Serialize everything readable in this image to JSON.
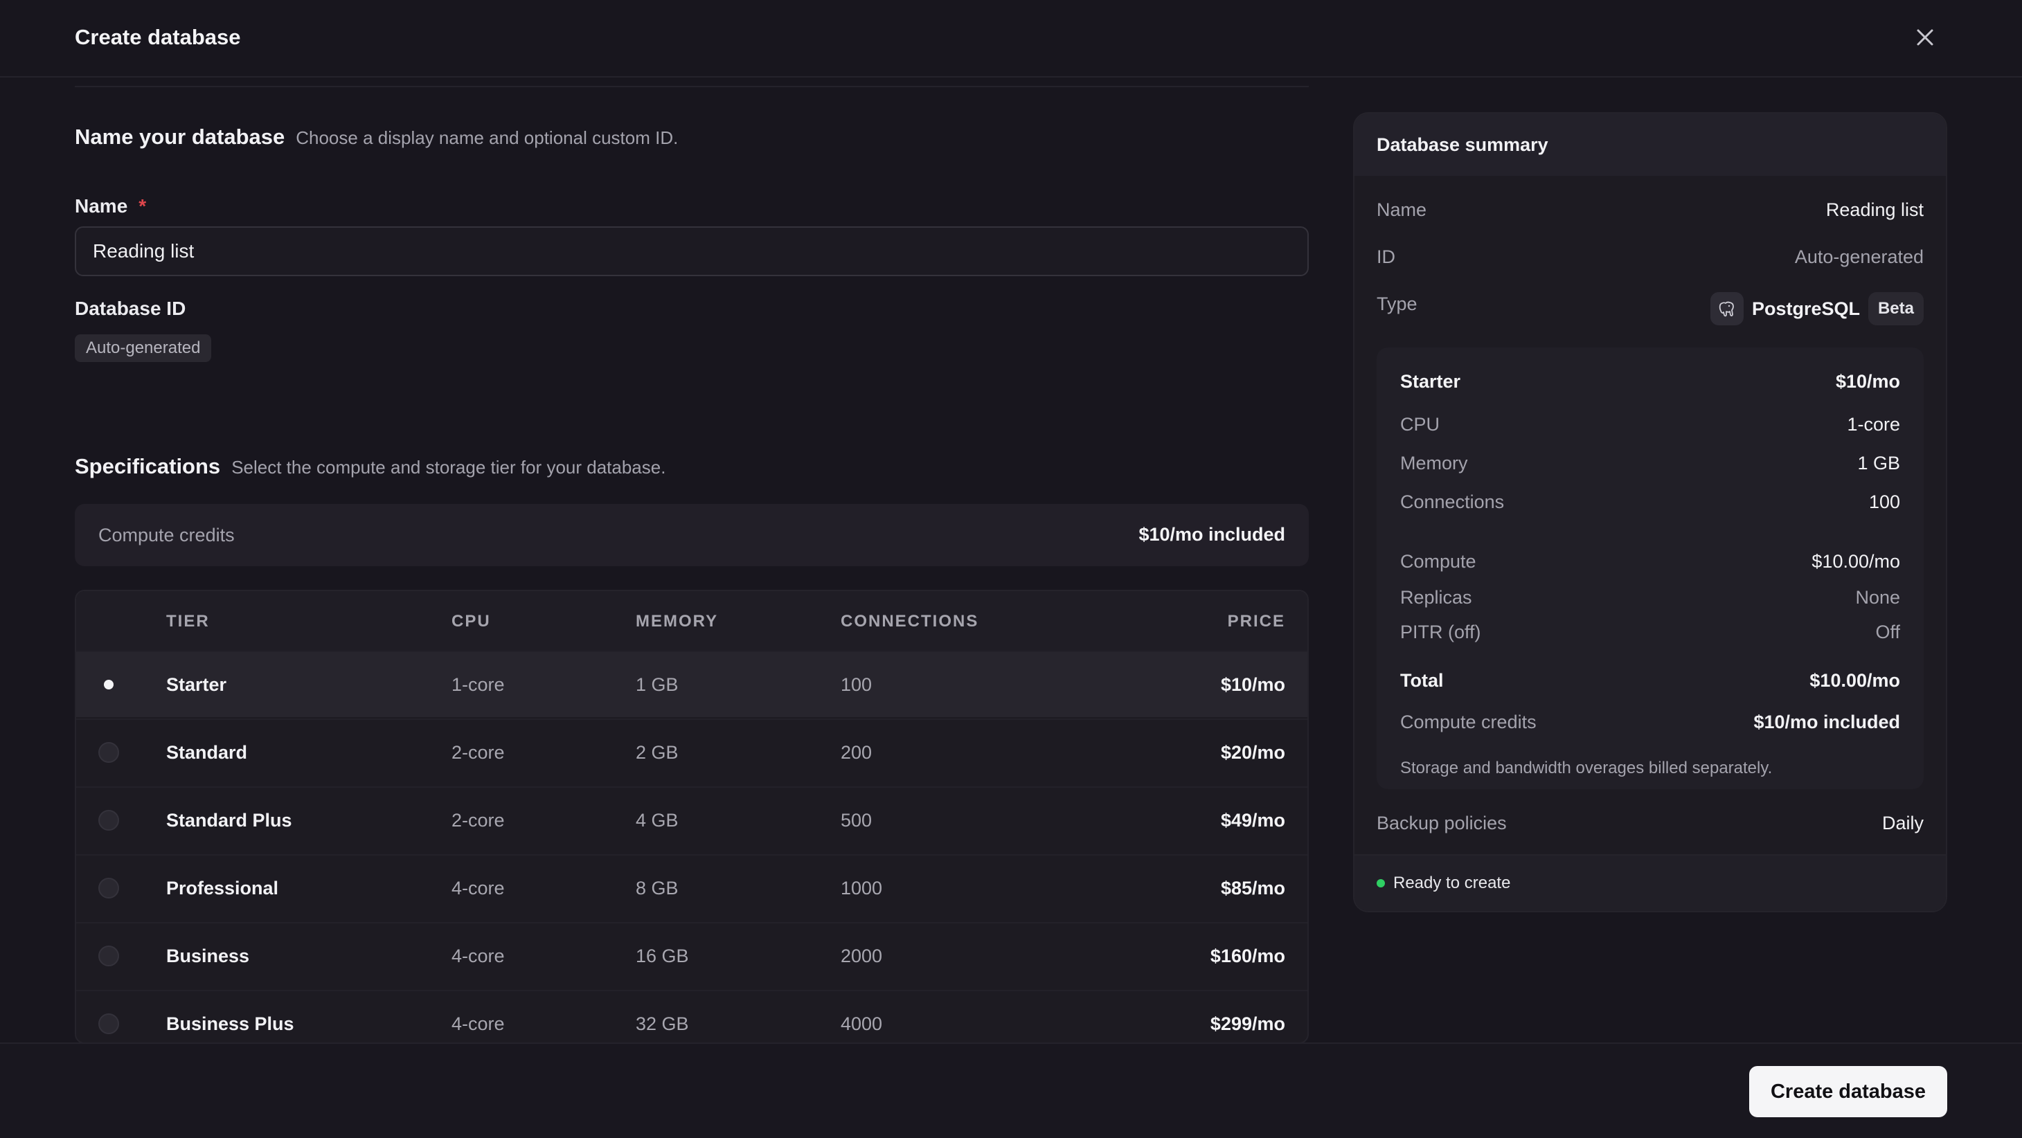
{
  "dialog": {
    "title": "Create database"
  },
  "name_section": {
    "heading": "Name your database",
    "subheading": "Choose a display name and optional custom ID.",
    "name_label": "Name",
    "required_mark": "*",
    "name_value": "Reading list",
    "id_label": "Database ID",
    "id_value": "Auto-generated"
  },
  "spec_section": {
    "heading": "Specifications",
    "subheading": "Select the compute and storage tier for your database.",
    "credits_label": "Compute credits",
    "credits_value": "$10/mo included"
  },
  "tier_table": {
    "headers": {
      "tier": "TIER",
      "cpu": "CPU",
      "memory": "MEMORY",
      "connections": "CONNECTIONS",
      "price": "PRICE"
    },
    "rows": [
      {
        "tier": "Starter",
        "cpu": "1-core",
        "memory": "1 GB",
        "connections": "100",
        "price": "$10/mo",
        "selected": true
      },
      {
        "tier": "Standard",
        "cpu": "2-core",
        "memory": "2 GB",
        "connections": "200",
        "price": "$20/mo",
        "selected": false
      },
      {
        "tier": "Standard Plus",
        "cpu": "2-core",
        "memory": "4 GB",
        "connections": "500",
        "price": "$49/mo",
        "selected": false
      },
      {
        "tier": "Professional",
        "cpu": "4-core",
        "memory": "8 GB",
        "connections": "1000",
        "price": "$85/mo",
        "selected": false
      },
      {
        "tier": "Business",
        "cpu": "4-core",
        "memory": "16 GB",
        "connections": "2000",
        "price": "$160/mo",
        "selected": false
      },
      {
        "tier": "Business Plus",
        "cpu": "4-core",
        "memory": "32 GB",
        "connections": "4000",
        "price": "$299/mo",
        "selected": false
      }
    ]
  },
  "summary": {
    "title": "Database summary",
    "name_label": "Name",
    "name_value": "Reading list",
    "id_label": "ID",
    "id_value": "Auto-generated",
    "type_label": "Type",
    "type_value": "PostgreSQL",
    "type_badge": "Beta",
    "plan_name": "Starter",
    "plan_price": "$10/mo",
    "cpu_label": "CPU",
    "cpu_value": "1-core",
    "memory_label": "Memory",
    "memory_value": "1 GB",
    "connections_label": "Connections",
    "connections_value": "100",
    "compute_label": "Compute",
    "compute_value": "$10.00/mo",
    "replicas_label": "Replicas",
    "replicas_value": "None",
    "pitr_label": "PITR (off)",
    "pitr_value": "Off",
    "total_label": "Total",
    "total_value": "$10.00/mo",
    "credits_label": "Compute credits",
    "credits_value": "$10/mo included",
    "note": "Storage and bandwidth overages billed separately.",
    "backup_label": "Backup policies",
    "backup_value": "Daily",
    "status": "Ready to create"
  },
  "footer": {
    "create_label": "Create database"
  },
  "colors": {
    "background": "#18161e",
    "ready_dot": "#2fcf63",
    "required": "#e0464c",
    "primary_button": "#f5f5f7"
  },
  "icons": {
    "close": "close-icon",
    "postgres": "postgres-elephant-icon"
  }
}
